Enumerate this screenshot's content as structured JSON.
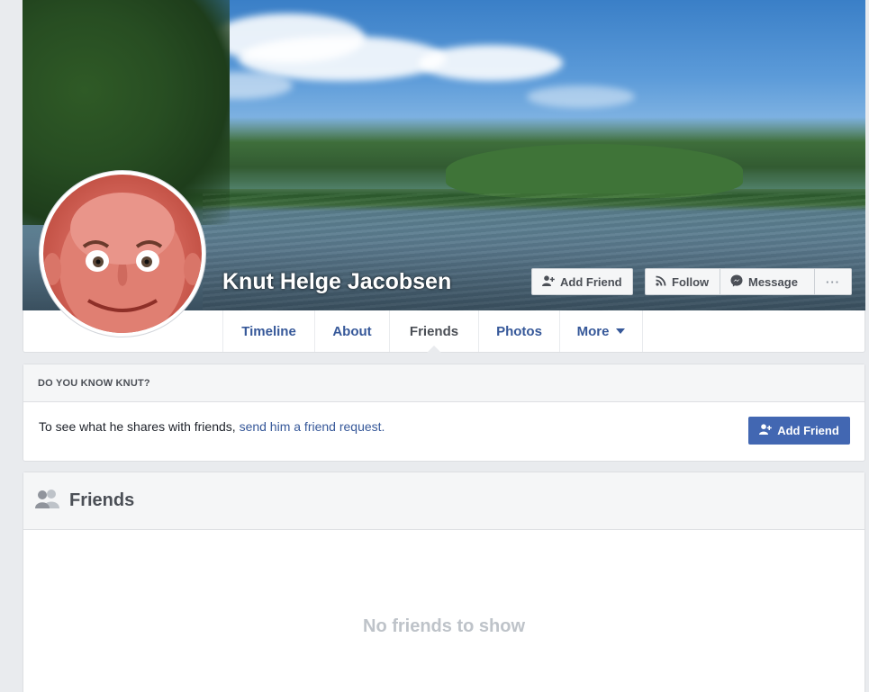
{
  "profile": {
    "name": "Knut Helge Jacobsen"
  },
  "cover_actions": {
    "add_friend": "Add Friend",
    "follow": "Follow",
    "message": "Message",
    "more": "···"
  },
  "tabs": [
    {
      "label": "Timeline",
      "active": false
    },
    {
      "label": "About",
      "active": false
    },
    {
      "label": "Friends",
      "active": true
    },
    {
      "label": "Photos",
      "active": false
    },
    {
      "label": "More",
      "active": false
    }
  ],
  "know_box": {
    "heading": "DO YOU KNOW KNUT?",
    "text": "To see what he shares with friends,",
    "link": "send him a friend request.",
    "button": "Add Friend"
  },
  "friends_box": {
    "title": "Friends",
    "empty_message": "No friends to show"
  },
  "colors": {
    "link": "#365899",
    "primary_button": "#4267b2",
    "page_bg": "#e9ebee"
  }
}
